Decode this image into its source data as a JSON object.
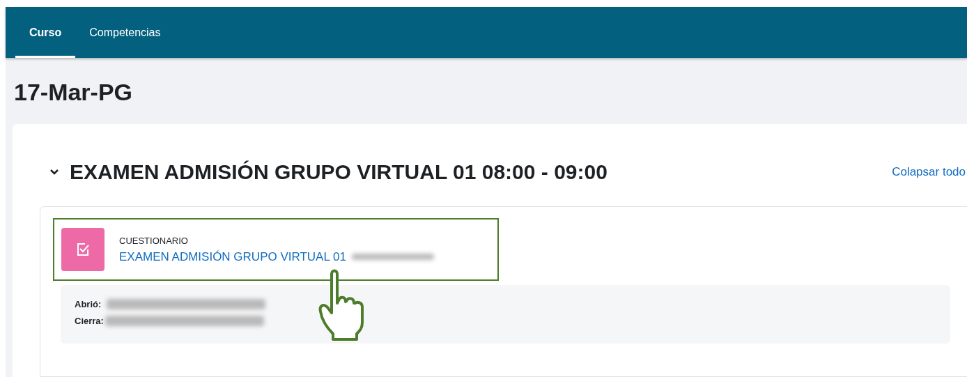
{
  "nav": {
    "tabs": [
      {
        "label": "Curso",
        "selected": true
      },
      {
        "label": "Competencias",
        "selected": false
      }
    ]
  },
  "page_title": "17-Mar-PG",
  "section": {
    "title": "EXAMEN ADMISIÓN GRUPO VIRTUAL 01 08:00 - 09:00",
    "expanded": true,
    "collapse_link": "Colapsar todo",
    "activity": {
      "type": "CUESTIONARIO",
      "name": "EXAMEN ADMISIÓN GRUPO VIRTUAL 01",
      "highlighted": true,
      "dates": [
        {
          "label": "Abrió:"
        },
        {
          "label": "Cierra:"
        }
      ]
    }
  }
}
